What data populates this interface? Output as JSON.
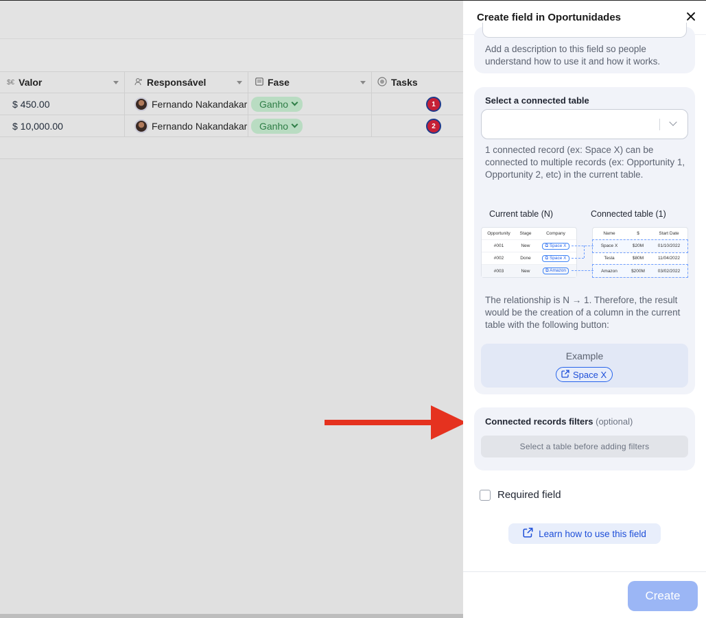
{
  "grid": {
    "headers": [
      {
        "icon": "$€",
        "label": "Valor"
      },
      {
        "icon": "👤",
        "label": "Responsável"
      },
      {
        "icon": "▤",
        "label": "Fase"
      },
      {
        "icon": "◎",
        "label": "Tasks"
      }
    ],
    "rows": [
      {
        "valor": "$ 450.00",
        "responsavel": "Fernando Nakandakari",
        "fase": "Ganho",
        "tasks": "1"
      },
      {
        "valor": "$ 10,000.00",
        "responsavel": "Fernando Nakandakari",
        "fase": "Ganho",
        "tasks": "2"
      }
    ]
  },
  "panel": {
    "title": "Create field in Oportunidades",
    "description_help": "Add a description to this field so people understand how to use it and how it works.",
    "connected_table": {
      "label": "Select a connected table",
      "help": "1 connected record (ex: Space X) can be connected to multiple records (ex: Opportunity 1, Opportunity 2, etc) in the current table.",
      "relationship_help": "The relationship is N → 1. Therefore, the result would be the creation of a column in the current table with the following button:"
    },
    "diagram": {
      "current_caption": "Current table (N)",
      "connected_caption": "Connected table (1)",
      "current_headers": [
        "Opportunity",
        "Stage",
        "Company"
      ],
      "current_rows": [
        [
          "#001",
          "New",
          "Space X"
        ],
        [
          "#002",
          "Done",
          "Space X"
        ],
        [
          "#003",
          "New",
          "Amazon"
        ]
      ],
      "connected_headers": [
        "Name",
        "$",
        "Start Date"
      ],
      "connected_rows": [
        [
          "Space X",
          "$20M",
          "01/10/2022"
        ],
        [
          "Tesla",
          "$80M",
          "11/04/2022"
        ],
        [
          "Amazon",
          "$200M",
          "03/02/2022"
        ]
      ]
    },
    "example": {
      "label": "Example",
      "button": "Space X"
    },
    "filters": {
      "label": "Connected records filters",
      "optional": "(optional)",
      "disabled_button": "Select a table before adding filters"
    },
    "required_label": "Required field",
    "learn_label": "Learn how to use this field",
    "create_label": "Create"
  },
  "colors": {
    "accent": "#1d4ed8",
    "create_disabled": "#9bb6f5",
    "arrow": "#e5321f",
    "stage_pill": "#b9dcc2"
  }
}
